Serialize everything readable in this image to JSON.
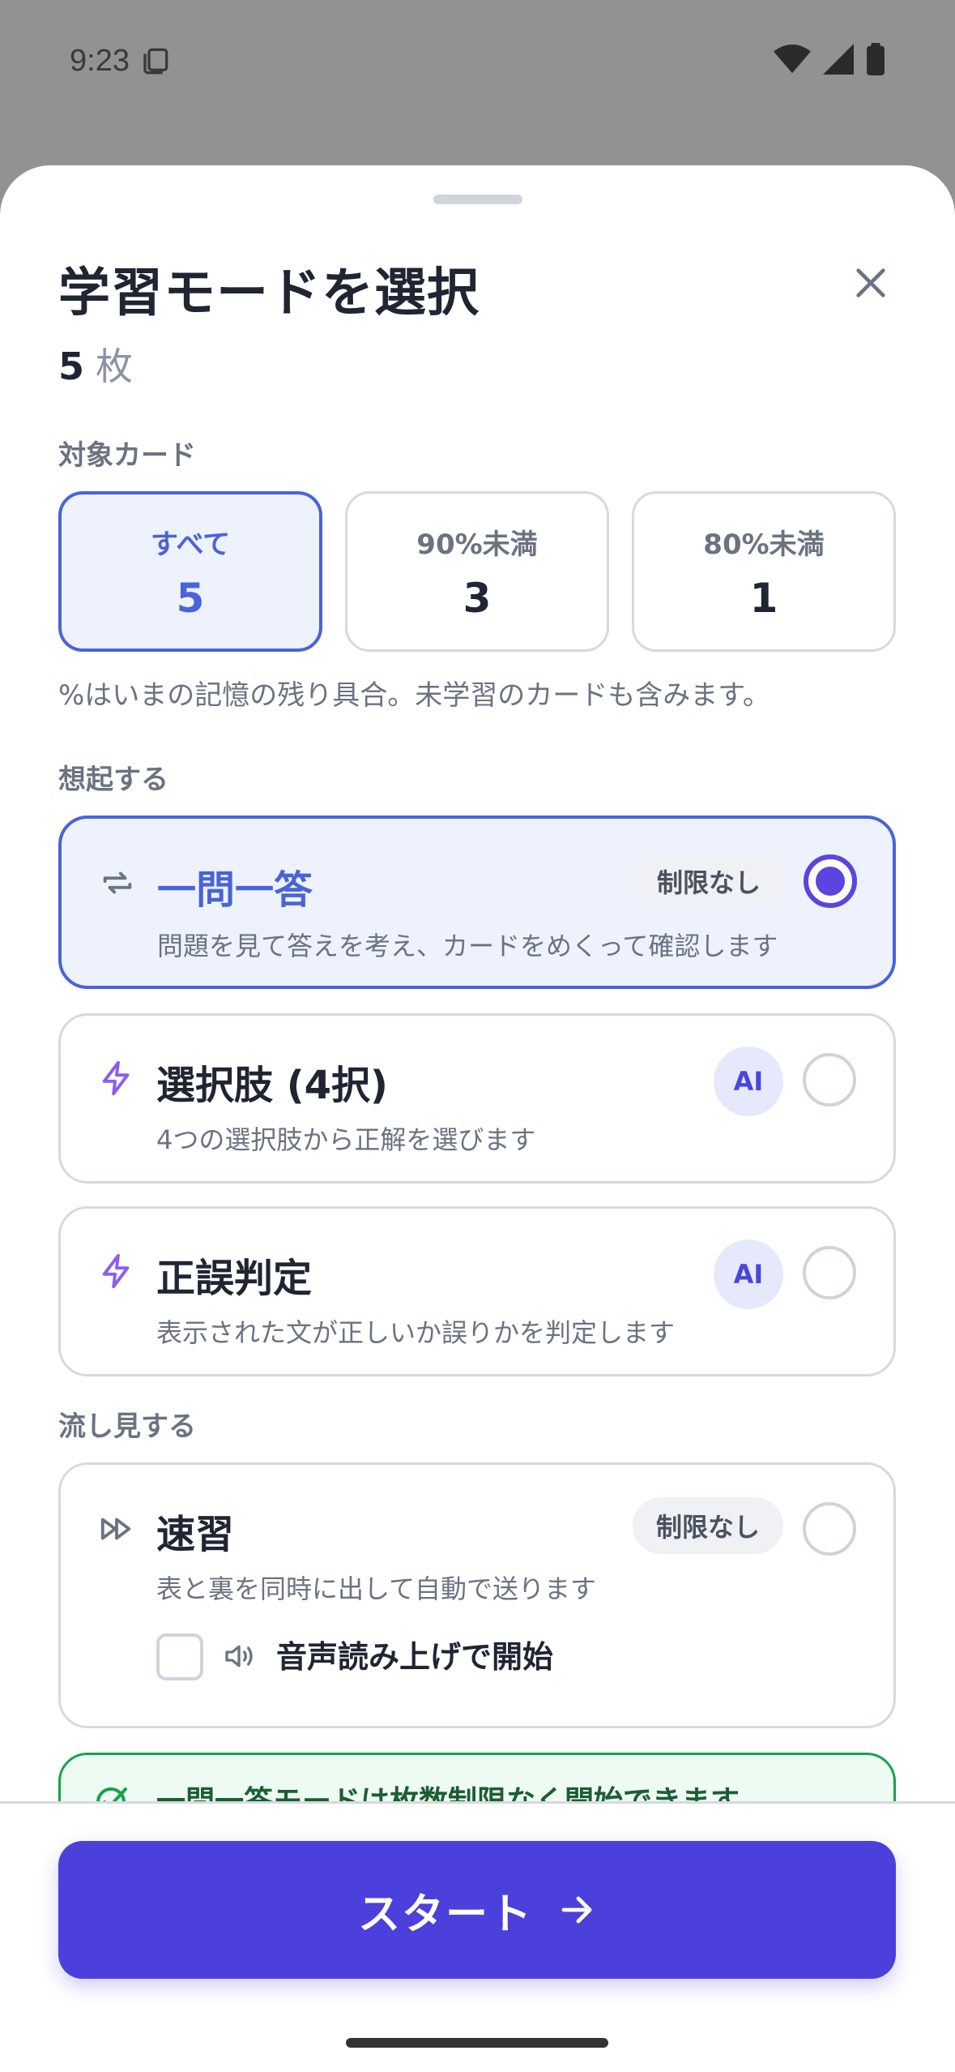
{
  "status_bar": {
    "time": "9:23"
  },
  "sheet": {
    "title": "学習モードを選択",
    "count_number": "5",
    "count_unit": "枚",
    "target_section_label": "対象カード",
    "targets": [
      {
        "label": "すべて",
        "value": "5"
      },
      {
        "label": "90%未満",
        "value": "3"
      },
      {
        "label": "80%未満",
        "value": "1"
      }
    ],
    "target_hint": "%はいまの記憶の残り具合。未学習のカードも含みます。",
    "recall_section_label": "想起する",
    "modes": [
      {
        "title": "一問一答",
        "description": "問題を見て答えを考え、カードをめくって確認します",
        "badge": "制限なし",
        "icon": "repeat-icon"
      },
      {
        "title": "選択肢 (4択)",
        "description": "4つの選択肢から正解を選びます",
        "badge": "AI",
        "icon": "lightning-icon"
      },
      {
        "title": "正誤判定",
        "description": "表示された文が正しいか誤りかを判定します",
        "badge": "AI",
        "icon": "lightning-icon"
      }
    ],
    "browse_section_label": "流し見する",
    "browse_mode": {
      "title": "速習",
      "description": "表と裏を同時に出して自動で送ります",
      "badge": "制限なし",
      "icon": "fast-forward-icon",
      "tts_label": "音声読み上げで開始"
    },
    "info_text": "一問一答モードは枚数制限なく開始できます"
  },
  "footer": {
    "start_label": "スタート",
    "icon": "arrow-right-icon"
  },
  "colors": {
    "accent": "#4b40db",
    "selected_border": "#4a63d9",
    "selected_bg": "#eef2fd"
  }
}
